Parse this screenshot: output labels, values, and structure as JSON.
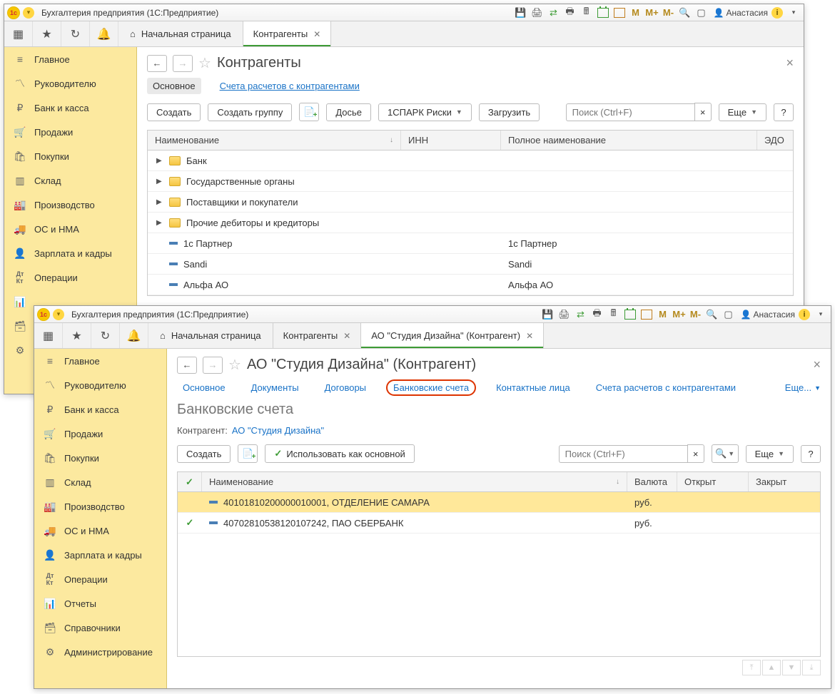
{
  "win1": {
    "title": "Бухгалтерия предприятия  (1С:Предприятие)",
    "user": "Анастасия",
    "m_labels": [
      "M",
      "M+",
      "M-"
    ],
    "tabs": {
      "home": "Начальная страница",
      "t1": "Контрагенты"
    },
    "sidebar": [
      "Главное",
      "Руководителю",
      "Банк и касса",
      "Продажи",
      "Покупки",
      "Склад",
      "Производство",
      "ОС и НМА",
      "Зарплата и кадры",
      "Операции"
    ],
    "page_title": "Контрагенты",
    "sub_tabs": {
      "main": "Основное",
      "accounts": "Счета расчетов с контрагентами"
    },
    "toolbar": {
      "create": "Создать",
      "create_group": "Создать группу",
      "dossier": "Досье",
      "spark": "1СПАРК Риски",
      "download": "Загрузить",
      "more": "Еще",
      "help": "?",
      "search_ph": "Поиск (Ctrl+F)"
    },
    "grid": {
      "cols": {
        "name": "Наименование",
        "inn": "ИНН",
        "fullname": "Полное наименование",
        "edo": "ЭДО"
      },
      "folders": [
        "Банк",
        "Государственные органы",
        "Поставщики и покупатели",
        "Прочие дебиторы и кредиторы"
      ],
      "rows": [
        {
          "name": "1с Партнер",
          "full": "1с Партнер"
        },
        {
          "name": "Sandi",
          "full": "Sandi"
        },
        {
          "name": "Альфа АО",
          "full": "Альфа АО"
        }
      ]
    }
  },
  "win2": {
    "title": "Бухгалтерия предприятия  (1С:Предприятие)",
    "user": "Анастасия",
    "m_labels": [
      "M",
      "M+",
      "M-"
    ],
    "tabs": {
      "home": "Начальная страница",
      "t1": "Контрагенты",
      "t2": "АО \"Студия Дизайна\" (Контрагент)"
    },
    "sidebar": [
      "Главное",
      "Руководителю",
      "Банк и касса",
      "Продажи",
      "Покупки",
      "Склад",
      "Производство",
      "ОС и НМА",
      "Зарплата и кадры",
      "Операции",
      "Отчеты",
      "Справочники",
      "Администрирование"
    ],
    "page_title": "АО \"Студия Дизайна\" (Контрагент)",
    "sub_tabs": {
      "main": "Основное",
      "docs": "Документы",
      "contracts": "Договоры",
      "bank": "Банковские счета",
      "contacts": "Контактные лица",
      "settl": "Счета расчетов с контрагентами",
      "more": "Еще..."
    },
    "subtitle": "Банковские счета",
    "kv": {
      "label": "Контрагент:",
      "value": "АО \"Студия Дизайна\""
    },
    "toolbar": {
      "create": "Создать",
      "use_main": "Использовать как основной",
      "more": "Еще",
      "help": "?",
      "search_ph": "Поиск (Ctrl+F)"
    },
    "grid": {
      "cols": {
        "mark": "",
        "name": "Наименование",
        "cur": "Валюта",
        "open": "Открыт",
        "close": "Закрыт"
      },
      "rows": [
        {
          "main": false,
          "name": "40101810200000010001, ОТДЕЛЕНИЕ САМАРА",
          "cur": "руб.",
          "open": "",
          "close": "",
          "hl": true
        },
        {
          "main": true,
          "name": "40702810538120107242, ПАО СБЕРБАНК",
          "cur": "руб.",
          "open": "",
          "close": "",
          "hl": false
        }
      ]
    }
  }
}
